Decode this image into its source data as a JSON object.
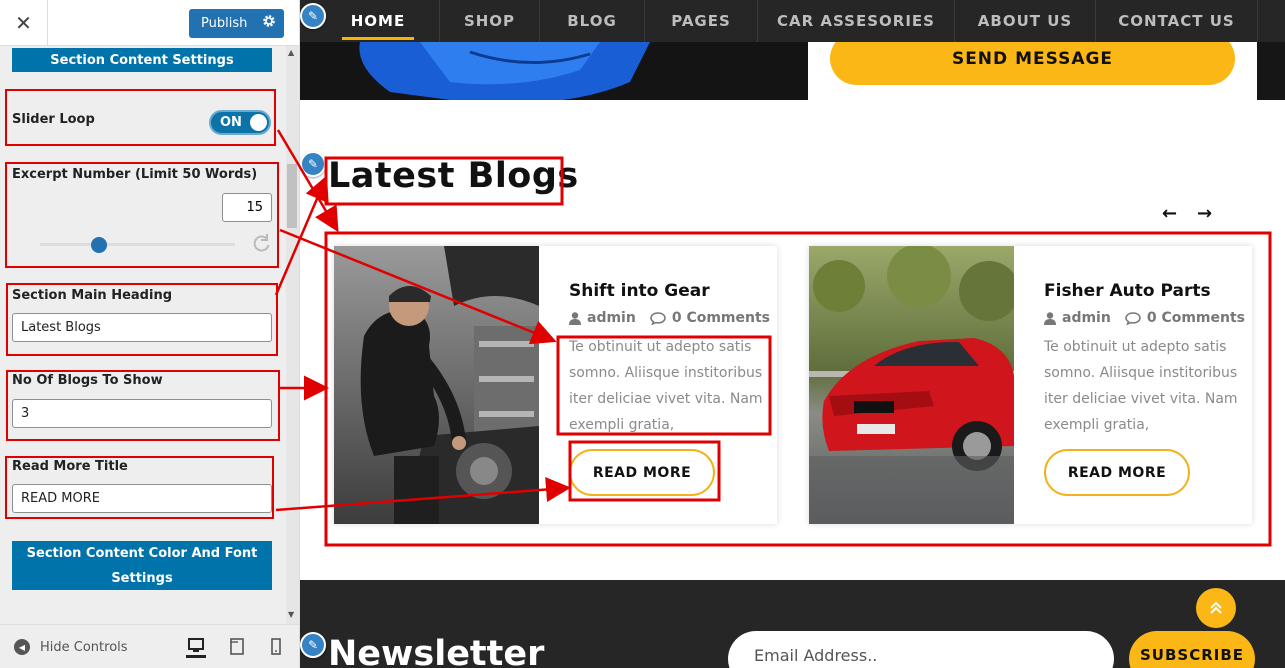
{
  "sidebar": {
    "close_glyph": "✕",
    "publish_label": "Publish",
    "section_content_settings": "Section Content Settings",
    "slider_loop": {
      "label": "Slider Loop",
      "toggle_text": "ON",
      "value": true
    },
    "excerpt": {
      "label": "Excerpt Number (Limit 50 Words)",
      "value": "15",
      "level_fraction": 0.3
    },
    "main_heading": {
      "label": "Section Main Heading",
      "value": "Latest Blogs"
    },
    "blogs_count": {
      "label": "No Of Blogs To Show",
      "value": "3"
    },
    "read_more": {
      "label": "Read More Title",
      "value": "READ MORE"
    },
    "color_font_settings": "Section Content Color And Font Settings",
    "footer": {
      "hide_controls": "Hide Controls"
    }
  },
  "nav": {
    "items": [
      "HOME",
      "SHOP",
      "BLOG",
      "PAGES",
      "CAR ASSESORIES",
      "ABOUT US",
      "CONTACT US"
    ],
    "active": "HOME",
    "accent": "#f7b500"
  },
  "hero": {
    "send_button": "SEND MESSAGE"
  },
  "blogs": {
    "heading": "Latest Blogs",
    "prev_arrow": "←",
    "next_arrow": "→",
    "cards": [
      {
        "title": "Shift into Gear",
        "author": "admin",
        "comments": "0 Comments",
        "excerpt": "Te obtinuit ut adepto satis somno. Aliisque institoribus iter deliciae vivet vita. Nam exempli gratia,",
        "button": "READ MORE",
        "image_icon": "mechanic-photo"
      },
      {
        "title": "Fisher Auto Parts",
        "author": "admin",
        "comments": "0 Comments",
        "excerpt": "Te obtinuit ut adepto satis somno. Aliisque institoribus iter deliciae vivet vita. Nam exempli gratia,",
        "button": "READ MORE",
        "image_icon": "red-car-photo"
      }
    ]
  },
  "newsletter": {
    "heading": "Newsletter",
    "email_placeholder": "Email Address..",
    "subscribe": "SUBSCRIBE",
    "to_top_glyph": "»"
  },
  "colors": {
    "brand_blue": "#0073aa",
    "highlight_red": "#e00000",
    "accent_yellow": "#fbb715",
    "dark": "#262626"
  }
}
